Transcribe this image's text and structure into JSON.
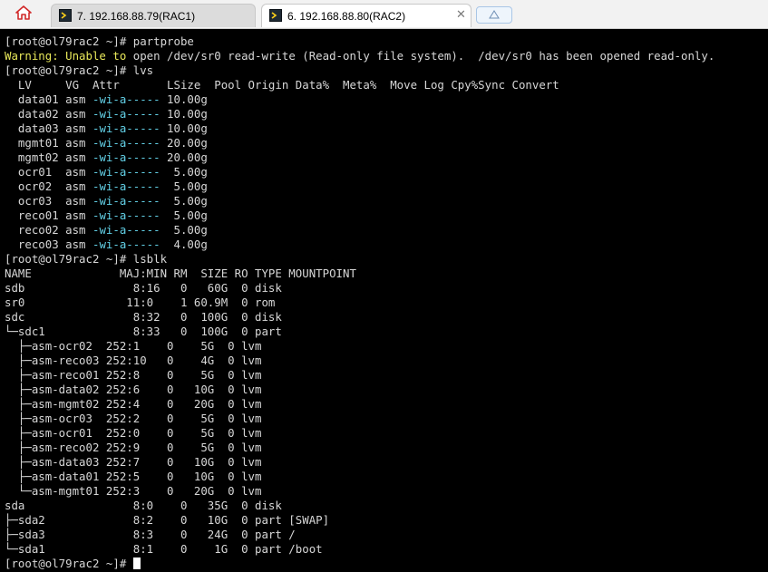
{
  "tabs": [
    {
      "label": "7. 192.168.88.79(RAC1)",
      "active": false
    },
    {
      "label": "6. 192.168.88.80(RAC2)",
      "active": true
    }
  ],
  "colors": {
    "terminal_bg": "#000000",
    "warning": "#e8e85a",
    "attr": "#62d0e6",
    "text": "#d7d7d7"
  },
  "terminal": {
    "lines": [
      {
        "parts": [
          {
            "text": "[root@ol79rac2 ~]# partprobe"
          }
        ]
      },
      {
        "parts": [
          {
            "text": "Warning: Unable to",
            "style": "yellow"
          },
          {
            "text": " open /dev/sr0 read-write (Read-only file system).  /dev/sr0 has been opened read-only."
          }
        ]
      },
      {
        "parts": [
          {
            "text": "[root@ol79rac2 ~]# lvs"
          }
        ]
      },
      {
        "parts": [
          {
            "text": "  LV     VG  Attr       LSize  Pool Origin Data%  Meta%  Move Log Cpy%Sync Convert"
          }
        ]
      },
      {
        "parts": [
          {
            "text": "  data01 asm "
          },
          {
            "text": "-wi-a-----",
            "style": "cyan"
          },
          {
            "text": " 10.00g"
          }
        ]
      },
      {
        "parts": [
          {
            "text": "  data02 asm "
          },
          {
            "text": "-wi-a-----",
            "style": "cyan"
          },
          {
            "text": " 10.00g"
          }
        ]
      },
      {
        "parts": [
          {
            "text": "  data03 asm "
          },
          {
            "text": "-wi-a-----",
            "style": "cyan"
          },
          {
            "text": " 10.00g"
          }
        ]
      },
      {
        "parts": [
          {
            "text": "  mgmt01 asm "
          },
          {
            "text": "-wi-a-----",
            "style": "cyan"
          },
          {
            "text": " 20.00g"
          }
        ]
      },
      {
        "parts": [
          {
            "text": "  mgmt02 asm "
          },
          {
            "text": "-wi-a-----",
            "style": "cyan"
          },
          {
            "text": " 20.00g"
          }
        ]
      },
      {
        "parts": [
          {
            "text": "  ocr01  asm "
          },
          {
            "text": "-wi-a-----",
            "style": "cyan"
          },
          {
            "text": "  5.00g"
          }
        ]
      },
      {
        "parts": [
          {
            "text": "  ocr02  asm "
          },
          {
            "text": "-wi-a-----",
            "style": "cyan"
          },
          {
            "text": "  5.00g"
          }
        ]
      },
      {
        "parts": [
          {
            "text": "  ocr03  asm "
          },
          {
            "text": "-wi-a-----",
            "style": "cyan"
          },
          {
            "text": "  5.00g"
          }
        ]
      },
      {
        "parts": [
          {
            "text": "  reco01 asm "
          },
          {
            "text": "-wi-a-----",
            "style": "cyan"
          },
          {
            "text": "  5.00g"
          }
        ]
      },
      {
        "parts": [
          {
            "text": "  reco02 asm "
          },
          {
            "text": "-wi-a-----",
            "style": "cyan"
          },
          {
            "text": "  5.00g"
          }
        ]
      },
      {
        "parts": [
          {
            "text": "  reco03 asm "
          },
          {
            "text": "-wi-a-----",
            "style": "cyan"
          },
          {
            "text": "  4.00g"
          }
        ]
      },
      {
        "parts": [
          {
            "text": "[root@ol79rac2 ~]# lsblk"
          }
        ]
      },
      {
        "parts": [
          {
            "text": "NAME             MAJ:MIN RM  SIZE RO TYPE MOUNTPOINT"
          }
        ]
      },
      {
        "parts": [
          {
            "text": "sdb                8:16   0   60G  0 disk"
          }
        ]
      },
      {
        "parts": [
          {
            "text": "sr0               11:0    1 60.9M  0 rom"
          }
        ]
      },
      {
        "parts": [
          {
            "text": "sdc                8:32   0  100G  0 disk"
          }
        ]
      },
      {
        "parts": [
          {
            "text": "└─sdc1             8:33   0  100G  0 part"
          }
        ]
      },
      {
        "parts": [
          {
            "text": "  ├─asm-ocr02  252:1    0    5G  0 lvm"
          }
        ]
      },
      {
        "parts": [
          {
            "text": "  ├─asm-reco03 252:10   0    4G  0 lvm"
          }
        ]
      },
      {
        "parts": [
          {
            "text": "  ├─asm-reco01 252:8    0    5G  0 lvm"
          }
        ]
      },
      {
        "parts": [
          {
            "text": "  ├─asm-data02 252:6    0   10G  0 lvm"
          }
        ]
      },
      {
        "parts": [
          {
            "text": "  ├─asm-mgmt02 252:4    0   20G  0 lvm"
          }
        ]
      },
      {
        "parts": [
          {
            "text": "  ├─asm-ocr03  252:2    0    5G  0 lvm"
          }
        ]
      },
      {
        "parts": [
          {
            "text": "  ├─asm-ocr01  252:0    0    5G  0 lvm"
          }
        ]
      },
      {
        "parts": [
          {
            "text": "  ├─asm-reco02 252:9    0    5G  0 lvm"
          }
        ]
      },
      {
        "parts": [
          {
            "text": "  ├─asm-data03 252:7    0   10G  0 lvm"
          }
        ]
      },
      {
        "parts": [
          {
            "text": "  ├─asm-data01 252:5    0   10G  0 lvm"
          }
        ]
      },
      {
        "parts": [
          {
            "text": "  └─asm-mgmt01 252:3    0   20G  0 lvm"
          }
        ]
      },
      {
        "parts": [
          {
            "text": "sda                8:0    0   35G  0 disk"
          }
        ]
      },
      {
        "parts": [
          {
            "text": "├─sda2             8:2    0   10G  0 part [SWAP]"
          }
        ]
      },
      {
        "parts": [
          {
            "text": "├─sda3             8:3    0   24G  0 part /"
          }
        ]
      },
      {
        "parts": [
          {
            "text": "└─sda1             8:1    0    1G  0 part /boot"
          }
        ]
      },
      {
        "parts": [
          {
            "text": "[root@ol79rac2 ~]# "
          }
        ],
        "cursor": true
      }
    ]
  }
}
